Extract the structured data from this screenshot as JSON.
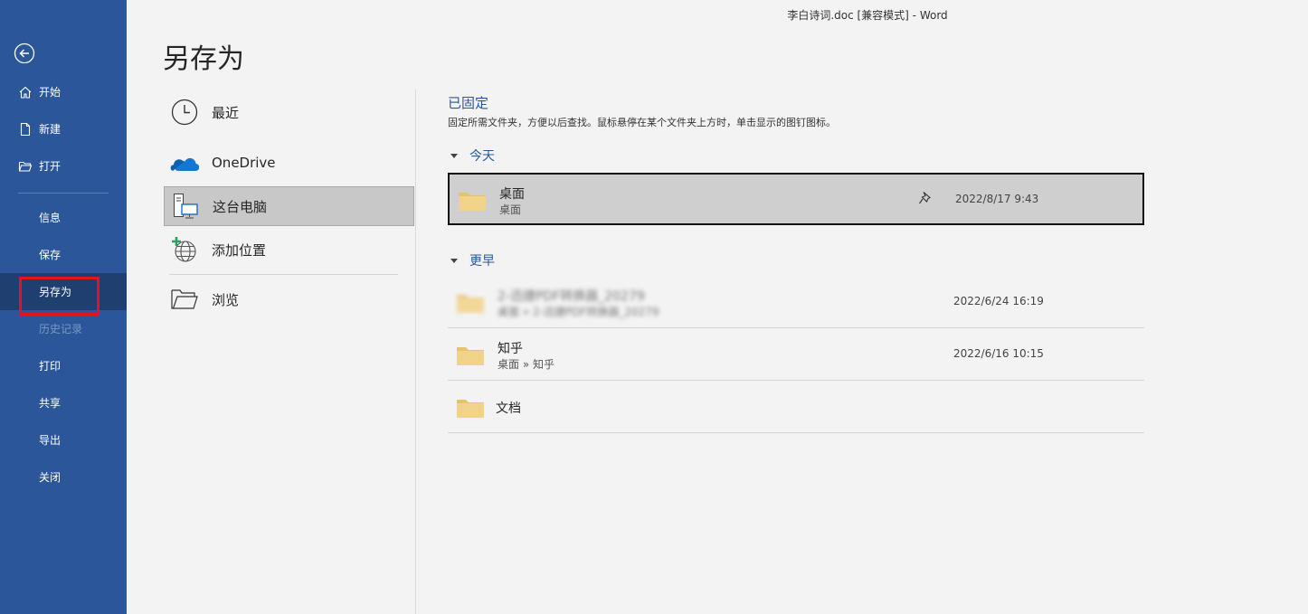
{
  "window": {
    "title": "李白诗词.doc [兼容模式]  -  Word"
  },
  "sidebar": {
    "back_icon": "back-arrow-icon",
    "primary_items": [
      {
        "label": "开始",
        "icon": "home-icon"
      },
      {
        "label": "新建",
        "icon": "new-document-icon"
      },
      {
        "label": "打开",
        "icon": "open-folder-icon"
      }
    ],
    "secondary_items": [
      {
        "label": "信息",
        "state": "normal"
      },
      {
        "label": "保存",
        "state": "normal"
      },
      {
        "label": "另存为",
        "state": "active"
      },
      {
        "label": "历史记录",
        "state": "disabled"
      },
      {
        "label": "打印",
        "state": "normal"
      },
      {
        "label": "共享",
        "state": "normal"
      },
      {
        "label": "导出",
        "state": "normal"
      },
      {
        "label": "关闭",
        "state": "normal"
      }
    ],
    "colors": {
      "background": "#2b579a",
      "active": "#1e3f6f",
      "highlight_outline": "#e8121e"
    }
  },
  "page": {
    "title": "另存为"
  },
  "locations": [
    {
      "label": "最近",
      "icon": "clock-icon",
      "selected": false
    },
    {
      "label": "OneDrive",
      "icon": "onedrive-cloud-icon",
      "selected": false
    },
    {
      "label": "这台电脑",
      "icon": "this-pc-icon",
      "selected": true
    },
    {
      "label": "添加位置",
      "icon": "add-location-globe-icon",
      "selected": false
    },
    {
      "label": "浏览",
      "icon": "browse-folder-icon",
      "selected": false
    }
  ],
  "pinned": {
    "title": "已固定",
    "hint": "固定所需文件夹，方便以后查找。鼠标悬停在某个文件夹上方时，单击显示的图钉图标。"
  },
  "groups": {
    "today": {
      "label": "今天",
      "items": [
        {
          "name": "桌面",
          "path": "桌面",
          "date": "2022/8/17 9:43",
          "selected": true
        }
      ]
    },
    "earlier": {
      "label": "更早",
      "items": [
        {
          "name": "2-迅捷PDF转换器_20279",
          "path": "桌面 » 2-迅捷PDF转换器_20279",
          "date": "2022/6/24 16:19",
          "blurred": true
        },
        {
          "name": "知乎",
          "path": "桌面 » 知乎",
          "date": "2022/6/16 10:15"
        },
        {
          "name": "文档",
          "path": "",
          "date": ""
        }
      ]
    }
  },
  "icons": {
    "pin": "pin-icon",
    "folder": "folder-icon",
    "expand": "collapse-triangle-icon"
  },
  "accent_color": "#2b579a"
}
